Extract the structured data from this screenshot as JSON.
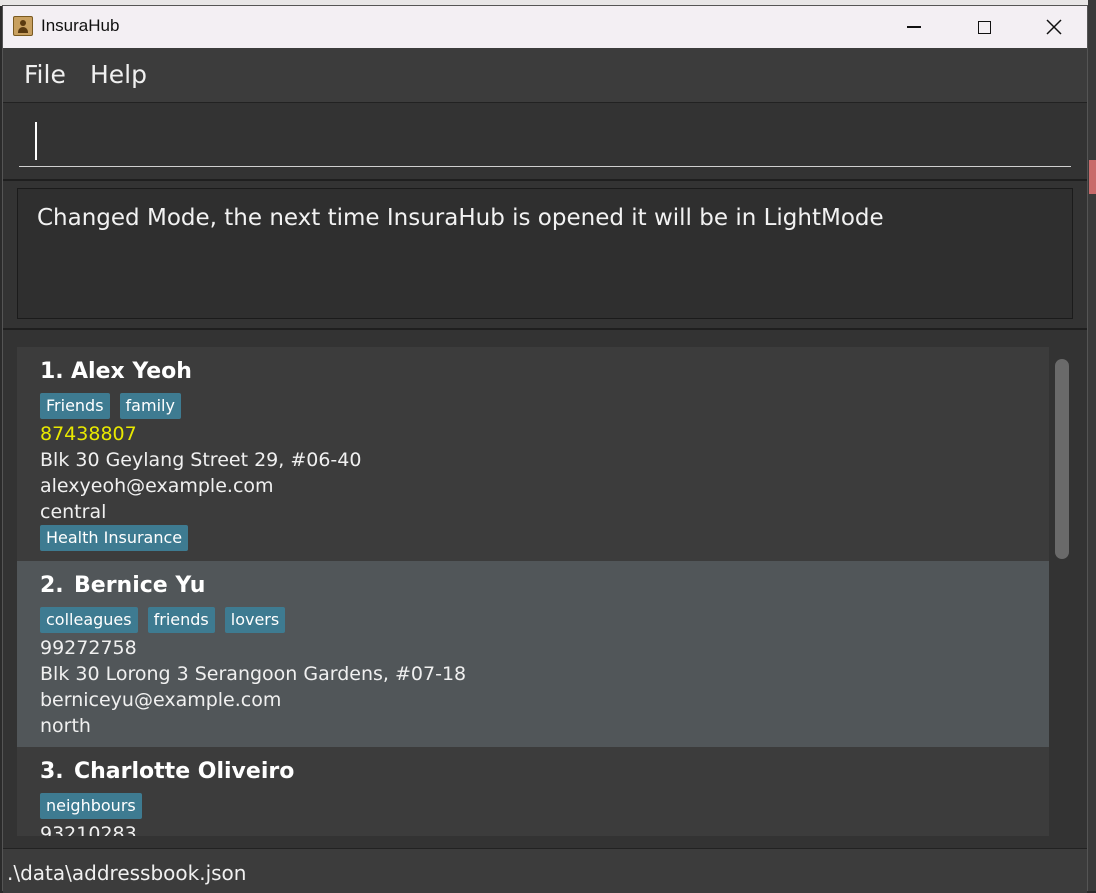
{
  "window": {
    "title": "InsuraHub"
  },
  "menu": {
    "file": "File",
    "help": "Help"
  },
  "command": {
    "value": "",
    "placeholder": ""
  },
  "result": {
    "message": "Changed Mode, the next time InsuraHub is opened it will be in LightMode"
  },
  "persons": [
    {
      "index": "1.",
      "name": "Alex Yeoh",
      "tags": [
        "Friends",
        "family"
      ],
      "phone": "87438807",
      "address": "Blk 30 Geylang Street 29, #06-40",
      "email": "alexyeoh@example.com",
      "region": "central",
      "policies": [
        "Health Insurance"
      ]
    },
    {
      "index": "2.",
      "name": "Bernice Yu",
      "tags": [
        "colleagues",
        "friends",
        "lovers"
      ],
      "phone": "99272758",
      "address": "Blk 30 Lorong 3 Serangoon Gardens, #07-18",
      "email": "berniceyu@example.com",
      "region": "north",
      "policies": []
    },
    {
      "index": "3.",
      "name": "Charlotte Oliveiro",
      "tags": [
        "neighbours"
      ],
      "phone": "93210283"
    }
  ],
  "status": {
    "file_path": ".\\data\\addressbook.json"
  },
  "colors": {
    "tag_bg": "#3e7b91",
    "phone_highlight": "#e8e800",
    "selected_card": "#515659"
  }
}
